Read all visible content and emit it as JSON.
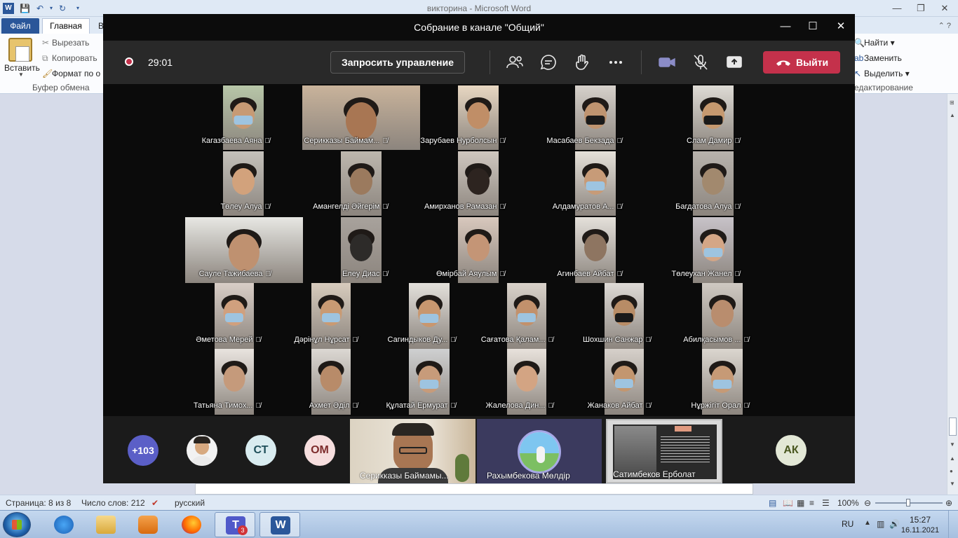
{
  "word": {
    "title": "викторина  -  Microsoft Word",
    "tabs": {
      "file": "Файл",
      "home": "Главная",
      "next": "В"
    },
    "clipboard": {
      "paste": "Вставить",
      "cut": "Вырезать",
      "copy": "Копировать",
      "format_painter": "Формат по о",
      "group_label": "Буфер обмена"
    },
    "editing": {
      "find": "Найти",
      "replace": "Заменить",
      "select": "Выделить",
      "group_label": "едактирование"
    },
    "status": {
      "page": "Страница: 8 из 8",
      "words": "Число слов: 212",
      "language": "русский",
      "zoom": "100%"
    }
  },
  "taskbar": {
    "language": "RU",
    "time": "15:27",
    "date": "16.11.2021",
    "teams_badge": "3"
  },
  "teams": {
    "title": "Собрание в канале \"Общий\"",
    "timer": "29:01",
    "request_control": "Запросить управление",
    "leave": "Выйти",
    "participants": [
      "Кагазбаева Аяна",
      "Серикказы Баймам...",
      "Зарубаев Нурболсын",
      "Масабаев Бекзада",
      "Слам Дамир",
      "Төлеу Алуа",
      "Амангелді Әйгерім",
      "Амирханов Рамазан",
      "Алдамуратов А...",
      "Багдатова Алуа",
      "Сауле Тажибаева",
      "Елеу Диас",
      "Өмірбай Аяулым",
      "Агинбаев Айбат",
      "Төлеухан Жанел",
      "Әметова Мерей",
      "Дәрінұл Нұрсат",
      "Сагиндыков Ду...",
      "Сағатова Қалам...",
      "Шохшин Санжар",
      "Абилқасымов ...",
      "Татьяна Тимох...",
      "Ахмет Әділ",
      "Құлатай Ермурат",
      "Жалелова Дин...",
      "Жанаков Айбат",
      "Нұржігіт Орал"
    ],
    "strip": {
      "more": "+103",
      "initials_1": "СТ",
      "initials_2": "ОМ",
      "initials_3": "АК",
      "video_1": "Серикказы Баймамы...",
      "video_2": "Рахымбекова Мөлдір",
      "video_3": "Сатимбеков Ерболат"
    }
  }
}
